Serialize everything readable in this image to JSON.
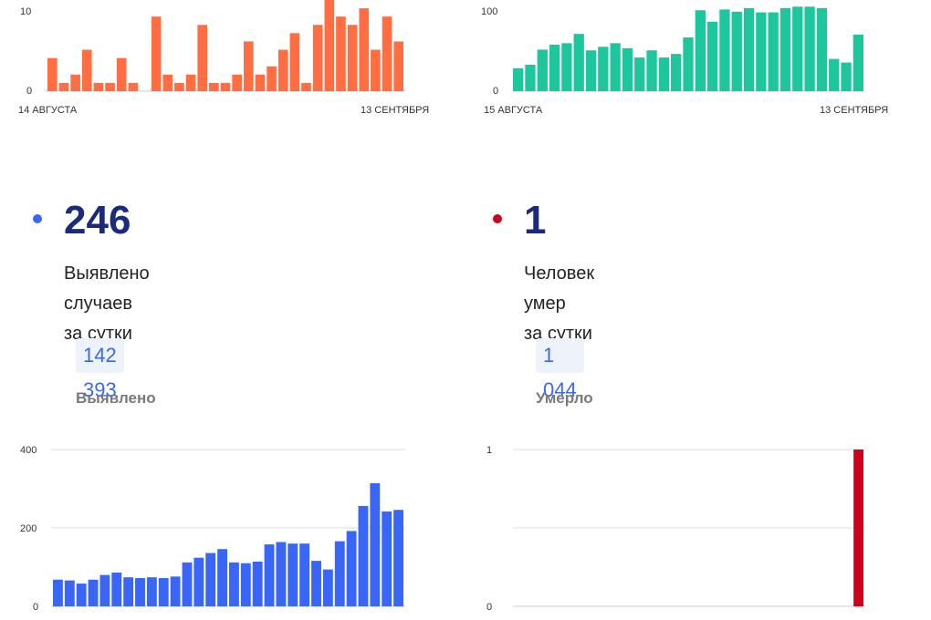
{
  "top_left": {
    "y_ticks": [
      "10",
      "0"
    ],
    "date_start": "14 АВГУСТА",
    "date_end": "13 СЕНТЯБРЯ"
  },
  "top_right": {
    "y_ticks": [
      "100",
      "0"
    ],
    "date_start": "15 АВГУСТА",
    "date_end": "13 СЕНТЯБРЯ"
  },
  "cases": {
    "value": "246",
    "label_line1": "Выявлено случаев",
    "label_line2": "за сутки",
    "total": "142 393",
    "total_label": "Выявлено"
  },
  "deaths": {
    "value": "1",
    "label_line1": "Человек умер",
    "label_line2": "за сутки",
    "total": "1 044",
    "total_label": "Умерло"
  },
  "bottom_left": {
    "y_ticks": [
      "400",
      "200",
      "0"
    ]
  },
  "bottom_right": {
    "y_ticks": [
      "1",
      "0"
    ]
  },
  "colors": {
    "orange": "#ff6e42",
    "teal": "#1ec69e",
    "blue": "#3a66f5",
    "red": "#d0021b",
    "dot_blue": "#3a66f5",
    "dot_red": "#d0021b"
  },
  "chart_data": [
    {
      "type": "bar",
      "series": [
        {
          "values": [
            4,
            1,
            2,
            5,
            1,
            1,
            4,
            1,
            0,
            9,
            2,
            1,
            2,
            8,
            1,
            1,
            2,
            6,
            2,
            3,
            5,
            7,
            1,
            8,
            12,
            9,
            8,
            10,
            5,
            9,
            6
          ]
        }
      ],
      "ylim": [
        0,
        11
      ],
      "x_range": [
        "14 АВГУСТА",
        "13 СЕНТЯБРЯ"
      ]
    },
    {
      "type": "bar",
      "series": [
        {
          "values": [
            32,
            37,
            58,
            65,
            67,
            80,
            57,
            62,
            67,
            60,
            47,
            57,
            47,
            52,
            75,
            113,
            97,
            114,
            111,
            116,
            110,
            110,
            116,
            118,
            118,
            116,
            45,
            40,
            79
          ]
        }
      ],
      "ylim": [
        0,
        112
      ],
      "x_range": [
        "15 АВГУСТА",
        "13 СЕНТЯБРЯ"
      ]
    },
    {
      "type": "bar",
      "series": [
        {
          "values": [
            68,
            66,
            58,
            68,
            80,
            86,
            74,
            72,
            74,
            72,
            76,
            112,
            124,
            136,
            146,
            112,
            110,
            114,
            158,
            164,
            160,
            160,
            116,
            94,
            166,
            192,
            256,
            314,
            242,
            246
          ]
        }
      ],
      "ylim": [
        0,
        400
      ]
    },
    {
      "type": "bar",
      "series": [
        {
          "values": [
            0,
            0,
            0,
            0,
            0,
            0,
            0,
            0,
            0,
            0,
            0,
            0,
            0,
            0,
            0,
            0,
            0,
            0,
            0,
            0,
            0,
            0,
            0,
            0,
            0,
            0,
            0,
            0,
            0,
            1
          ]
        }
      ],
      "ylim": [
        0,
        1
      ]
    }
  ]
}
